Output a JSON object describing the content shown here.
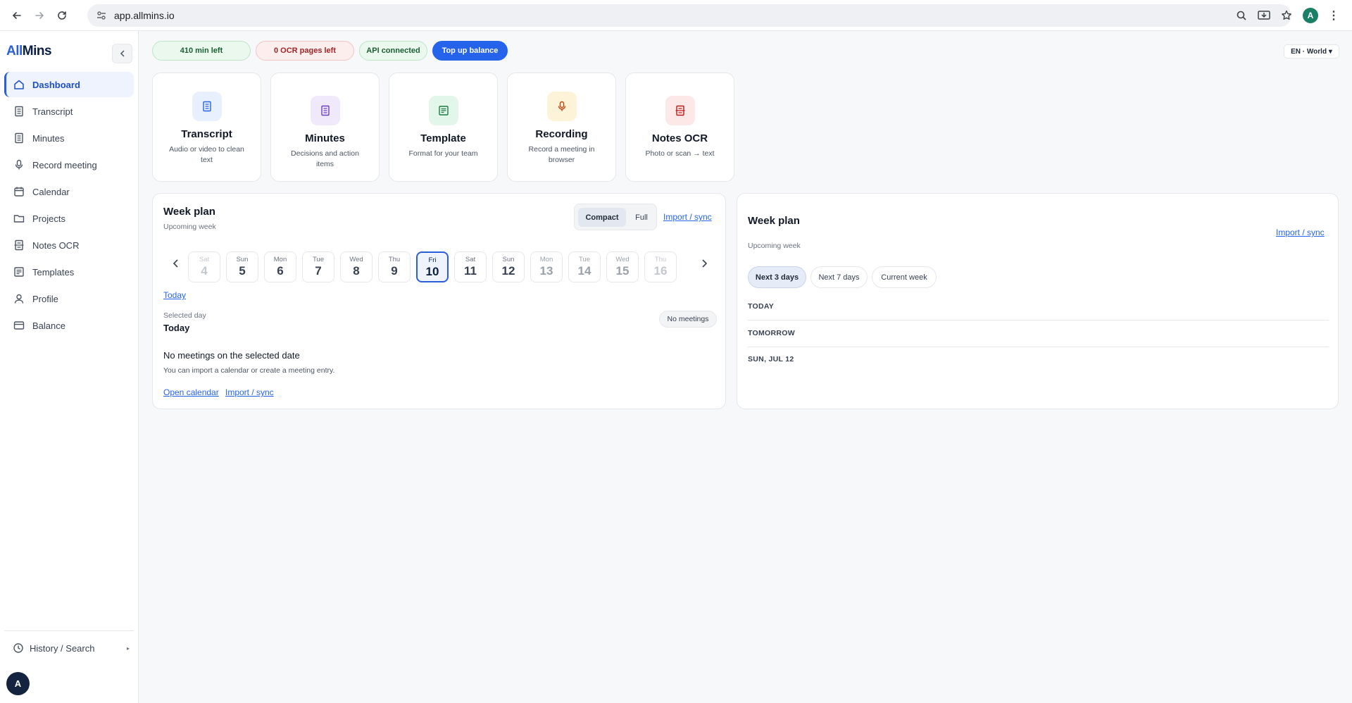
{
  "browser": {
    "url": "app.allmins.io",
    "profile_initial": "A"
  },
  "sidebar": {
    "logo": {
      "part1": "All",
      "part2": "Mins"
    },
    "items": [
      {
        "label": "Dashboard",
        "icon": "home-icon",
        "active": true
      },
      {
        "label": "Transcript",
        "icon": "document-icon"
      },
      {
        "label": "Minutes",
        "icon": "document-icon"
      },
      {
        "label": "Record meeting",
        "icon": "microphone-icon"
      },
      {
        "label": "Calendar",
        "icon": "calendar-icon"
      },
      {
        "label": "Projects",
        "icon": "folder-icon"
      },
      {
        "label": "Notes OCR",
        "icon": "scan-icon"
      },
      {
        "label": "Templates",
        "icon": "template-icon"
      },
      {
        "label": "Profile",
        "icon": "user-icon"
      },
      {
        "label": "Balance",
        "icon": "card-icon"
      }
    ],
    "history_label": "History / Search",
    "user_initial": "A"
  },
  "status": {
    "minutes_left": "410 min left",
    "ocr_left": "0 OCR pages left",
    "api": "API connected",
    "topup": "Top up balance",
    "language": "EN · World ▾"
  },
  "features": [
    {
      "title": "Transcript",
      "subtitle": "Audio or video to clean text",
      "icon": "document-icon",
      "color": "#2563eb",
      "bg": "#e8f0fd"
    },
    {
      "title": "Minutes",
      "subtitle": "Decisions and action items",
      "icon": "document-icon",
      "color": "#6d3fc0",
      "bg": "#efe9fb"
    },
    {
      "title": "Template",
      "subtitle": "Format for your team",
      "icon": "template-icon",
      "color": "#1c7a45",
      "bg": "#e3f6ea"
    },
    {
      "title": "Recording",
      "subtitle": "Record a meeting in browser",
      "icon": "microphone-icon",
      "color": "#c2410c",
      "bg": "#fdf3d8"
    },
    {
      "title": "Notes OCR",
      "subtitle": "Photo or scan → text",
      "icon": "scan-icon",
      "color": "#b91c1c",
      "bg": "#fde8e8"
    }
  ],
  "week_plan_left": {
    "title": "Week plan",
    "subtitle": "Upcoming week",
    "toggle": {
      "compact": "Compact",
      "full": "Full"
    },
    "import_sync": "Import / sync",
    "days": [
      {
        "wd": "Sat",
        "num": "4",
        "state": "faded"
      },
      {
        "wd": "Sun",
        "num": "5",
        "state": "normal"
      },
      {
        "wd": "Mon",
        "num": "6",
        "state": "normal"
      },
      {
        "wd": "Tue",
        "num": "7",
        "state": "normal"
      },
      {
        "wd": "Wed",
        "num": "8",
        "state": "normal"
      },
      {
        "wd": "Thu",
        "num": "9",
        "state": "normal"
      },
      {
        "wd": "Fri",
        "num": "10",
        "state": "selected"
      },
      {
        "wd": "Sat",
        "num": "11",
        "state": "normal"
      },
      {
        "wd": "Sun",
        "num": "12",
        "state": "normal"
      },
      {
        "wd": "Mon",
        "num": "13",
        "state": "faded2"
      },
      {
        "wd": "Tue",
        "num": "14",
        "state": "faded2"
      },
      {
        "wd": "Wed",
        "num": "15",
        "state": "faded2"
      },
      {
        "wd": "Thu",
        "num": "16",
        "state": "faded"
      }
    ],
    "today_link": "Today",
    "selected_label": "Selected day",
    "selected_value": "Today",
    "no_meetings_badge": "No meetings",
    "empty_title": "No meetings on the selected date",
    "empty_sub": "You can import a calendar or create a meeting entry.",
    "open_calendar": "Open calendar",
    "import_sync_2": "Import / sync"
  },
  "week_plan_right": {
    "title": "Week plan",
    "subtitle": "Upcoming week",
    "import_sync": "Import / sync",
    "chips": [
      "Next 3 days",
      "Next 7 days",
      "Current week"
    ],
    "sections": [
      "TODAY",
      "TOMORROW",
      "SUN, JUL 12"
    ]
  }
}
